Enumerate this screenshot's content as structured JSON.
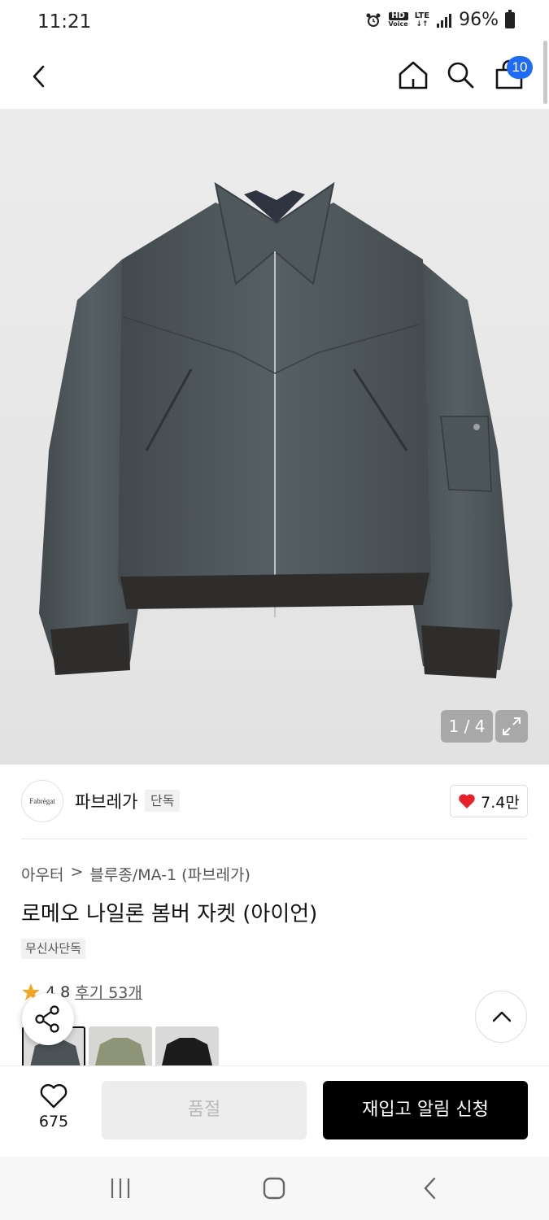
{
  "status_bar": {
    "time": "11:21",
    "hd_label": "HD",
    "voice_label": "Voice",
    "lte_label": "LTE",
    "battery": "96%"
  },
  "header": {
    "cart_count": "10"
  },
  "gallery": {
    "counter": "1 / 4"
  },
  "brand": {
    "logo_text": "Fabrègat",
    "name": "파브레가",
    "tag": "단독",
    "likes": "7.4만"
  },
  "product": {
    "breadcrumb_category": "아우터",
    "breadcrumb_separator": ">",
    "breadcrumb_subcategory": "블루종/MA-1 (파브레가)",
    "title": "로메오 나일론 봄버 자켓 (아이언)",
    "exclusive_badge": "무신사단독",
    "rating": "4.8",
    "review_link": "후기 53개"
  },
  "colors": {
    "accent_blue": "#1e6bf5",
    "heart_red": "#e8202a",
    "star_orange": "#f5a623",
    "jacket_gray": "#4b5356"
  },
  "action_bar": {
    "wish_count": "675",
    "soldout_label": "품절",
    "restock_label": "재입고 알림 신청"
  }
}
